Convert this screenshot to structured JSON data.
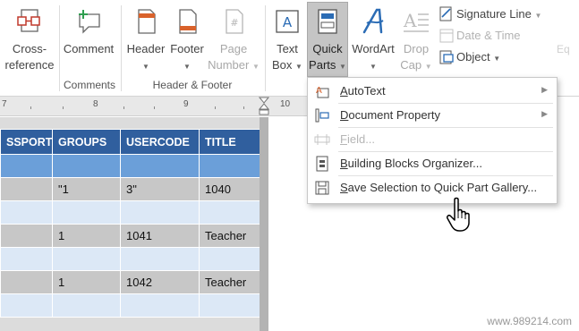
{
  "ribbon": {
    "insert_group": {
      "cross_reference": {
        "line1": "Cross-",
        "line2": "reference"
      },
      "comment": {
        "label": "Comment"
      }
    },
    "header_footer_group": {
      "header": {
        "label": "Header"
      },
      "footer": {
        "label": "Footer"
      },
      "page_number": {
        "line1": "Page",
        "line2": "Number"
      }
    },
    "text_group": {
      "text_box": {
        "line1": "Text",
        "line2": "Box"
      },
      "quick_parts": {
        "line1": "Quick",
        "line2": "Parts"
      },
      "wordart": {
        "label": "WordArt"
      },
      "drop_cap": {
        "line1": "Drop",
        "line2": "Cap"
      },
      "signature_line": {
        "label": "Signature Line"
      },
      "date_time": {
        "label": "Date & Time"
      },
      "object": {
        "label": "Object"
      }
    },
    "group_labels": {
      "comments": "Comments",
      "header_footer": "Header & Footer"
    },
    "clipped_right": "Eq"
  },
  "ruler": {
    "marks": [
      "7",
      "8",
      "9",
      "10"
    ]
  },
  "table": {
    "headers": [
      "SSPORT",
      "GROUPS",
      "USERCODE",
      "TITLE"
    ],
    "rows": [
      [
        "",
        "",
        "",
        ""
      ],
      [
        "",
        "\"1",
        "3\"",
        "1040"
      ],
      [
        "",
        "",
        "",
        ""
      ],
      [
        "",
        "1",
        "1041",
        "Teacher"
      ],
      [
        "",
        "",
        "",
        ""
      ],
      [
        "",
        "1",
        "1042",
        "Teacher"
      ],
      [
        "",
        "",
        "",
        ""
      ]
    ]
  },
  "quick_parts_menu": {
    "items": [
      {
        "label": "AutoText",
        "icon": "autotext-icon",
        "submenu": true,
        "enabled": true
      },
      {
        "label": "Document Property",
        "icon": "document-property-icon",
        "submenu": true,
        "enabled": true
      },
      {
        "label": "Field...",
        "icon": "field-icon",
        "submenu": false,
        "enabled": false
      },
      {
        "label": "Building Blocks Organizer...",
        "icon": "building-blocks-icon",
        "submenu": false,
        "enabled": true
      },
      {
        "label": "Save Selection to Quick Part Gallery...",
        "icon": "save-selection-icon",
        "submenu": false,
        "enabled": true
      }
    ]
  },
  "watermark": "www.989214.com",
  "colors": {
    "accent": "#305f9e",
    "table_band": "#6b9fd9",
    "table_light": "#dce8f6",
    "table_gray": "#c7c7c7",
    "wordart_blue": "#2b6cb5"
  }
}
